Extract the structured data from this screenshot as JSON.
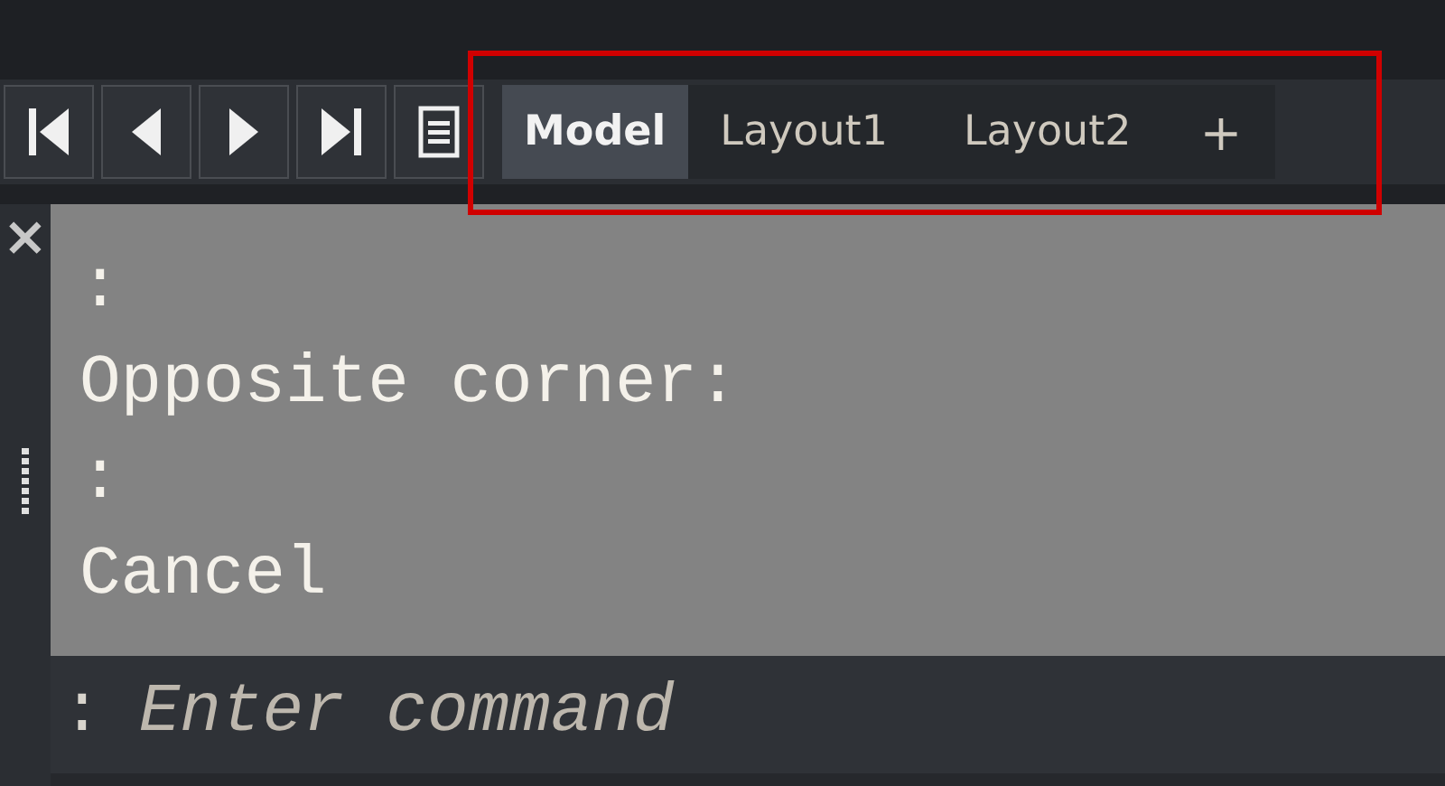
{
  "nav_buttons": [
    {
      "kind": "first"
    },
    {
      "kind": "prev"
    },
    {
      "kind": "next"
    },
    {
      "kind": "last"
    },
    {
      "kind": "list"
    }
  ],
  "tabs": [
    {
      "label": "Model",
      "selected": true
    },
    {
      "label": "Layout1",
      "selected": false
    },
    {
      "label": "Layout2",
      "selected": false
    }
  ],
  "add_tab": "+",
  "command_line": {
    "close": "×",
    "history": [
      ":",
      "Opposite corner:",
      ":",
      "Cancel"
    ],
    "prompt": ":",
    "placeholder": "Enter command"
  }
}
